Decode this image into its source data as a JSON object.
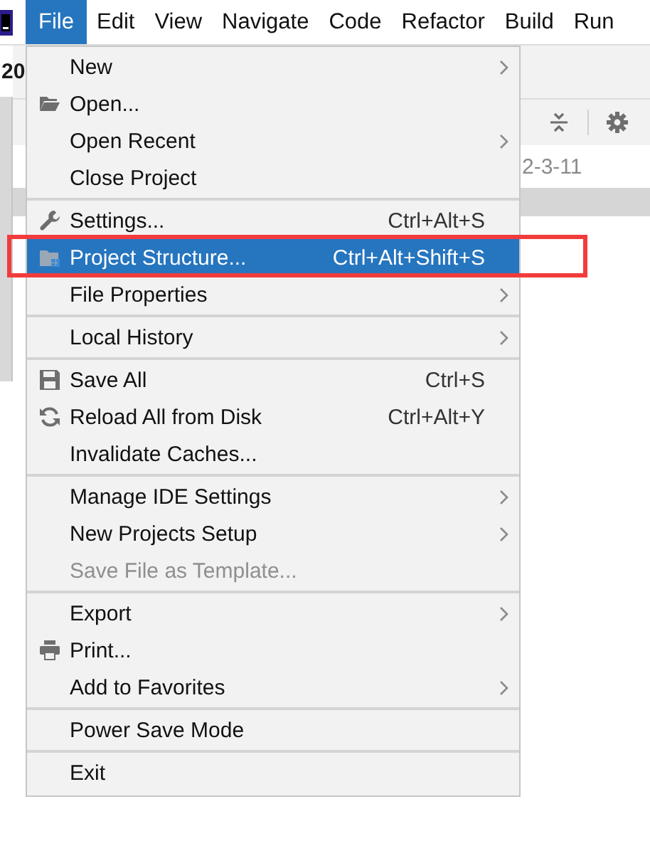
{
  "menubar": [
    {
      "label": "File",
      "selected": true
    },
    {
      "label": "Edit",
      "selected": false
    },
    {
      "label": "View",
      "selected": false
    },
    {
      "label": "Navigate",
      "selected": false
    },
    {
      "label": "Code",
      "selected": false
    },
    {
      "label": "Refactor",
      "selected": false
    },
    {
      "label": "Build",
      "selected": false
    },
    {
      "label": "Run",
      "selected": false
    }
  ],
  "workspace": {
    "title": "20",
    "date": "2-3-11"
  },
  "file_menu": [
    {
      "kind": "item",
      "label": "New",
      "submenu": true,
      "selected": false,
      "disabled": false
    },
    {
      "kind": "item",
      "label": "Open...",
      "submenu": false,
      "selected": false,
      "disabled": false
    },
    {
      "kind": "item",
      "label": "Open Recent",
      "submenu": true,
      "selected": false,
      "disabled": false
    },
    {
      "kind": "item",
      "label": "Close Project",
      "submenu": false,
      "selected": false,
      "disabled": false
    },
    {
      "kind": "separator"
    },
    {
      "kind": "item",
      "label": "Settings...",
      "shortcut": "Ctrl+Alt+S",
      "submenu": false,
      "selected": false,
      "disabled": false
    },
    {
      "kind": "item",
      "label": "Project Structure...",
      "shortcut": "Ctrl+Alt+Shift+S",
      "submenu": false,
      "selected": true,
      "disabled": false,
      "highlighted": true
    },
    {
      "kind": "item",
      "label": "File Properties",
      "submenu": true,
      "selected": false,
      "disabled": false
    },
    {
      "kind": "separator"
    },
    {
      "kind": "item",
      "label": "Local History",
      "submenu": true,
      "selected": false,
      "disabled": false
    },
    {
      "kind": "separator"
    },
    {
      "kind": "item",
      "label": "Save All",
      "shortcut": "Ctrl+S",
      "submenu": false,
      "selected": false,
      "disabled": false
    },
    {
      "kind": "item",
      "label": "Reload All from Disk",
      "shortcut": "Ctrl+Alt+Y",
      "submenu": false,
      "selected": false,
      "disabled": false
    },
    {
      "kind": "item",
      "label": "Invalidate Caches...",
      "submenu": false,
      "selected": false,
      "disabled": false
    },
    {
      "kind": "separator"
    },
    {
      "kind": "item",
      "label": "Manage IDE Settings",
      "submenu": true,
      "selected": false,
      "disabled": false
    },
    {
      "kind": "item",
      "label": "New Projects Setup",
      "submenu": true,
      "selected": false,
      "disabled": false
    },
    {
      "kind": "item",
      "label": "Save File as Template...",
      "submenu": false,
      "selected": false,
      "disabled": true
    },
    {
      "kind": "separator"
    },
    {
      "kind": "item",
      "label": "Export",
      "submenu": true,
      "selected": false,
      "disabled": false
    },
    {
      "kind": "item",
      "label": "Print...",
      "submenu": false,
      "selected": false,
      "disabled": false
    },
    {
      "kind": "item",
      "label": "Add to Favorites",
      "submenu": true,
      "selected": false,
      "disabled": false
    },
    {
      "kind": "separator"
    },
    {
      "kind": "item",
      "label": "Power Save Mode",
      "submenu": false,
      "selected": false,
      "disabled": false
    },
    {
      "kind": "separator"
    },
    {
      "kind": "item",
      "label": "Exit",
      "submenu": false,
      "selected": false,
      "disabled": false
    }
  ]
}
